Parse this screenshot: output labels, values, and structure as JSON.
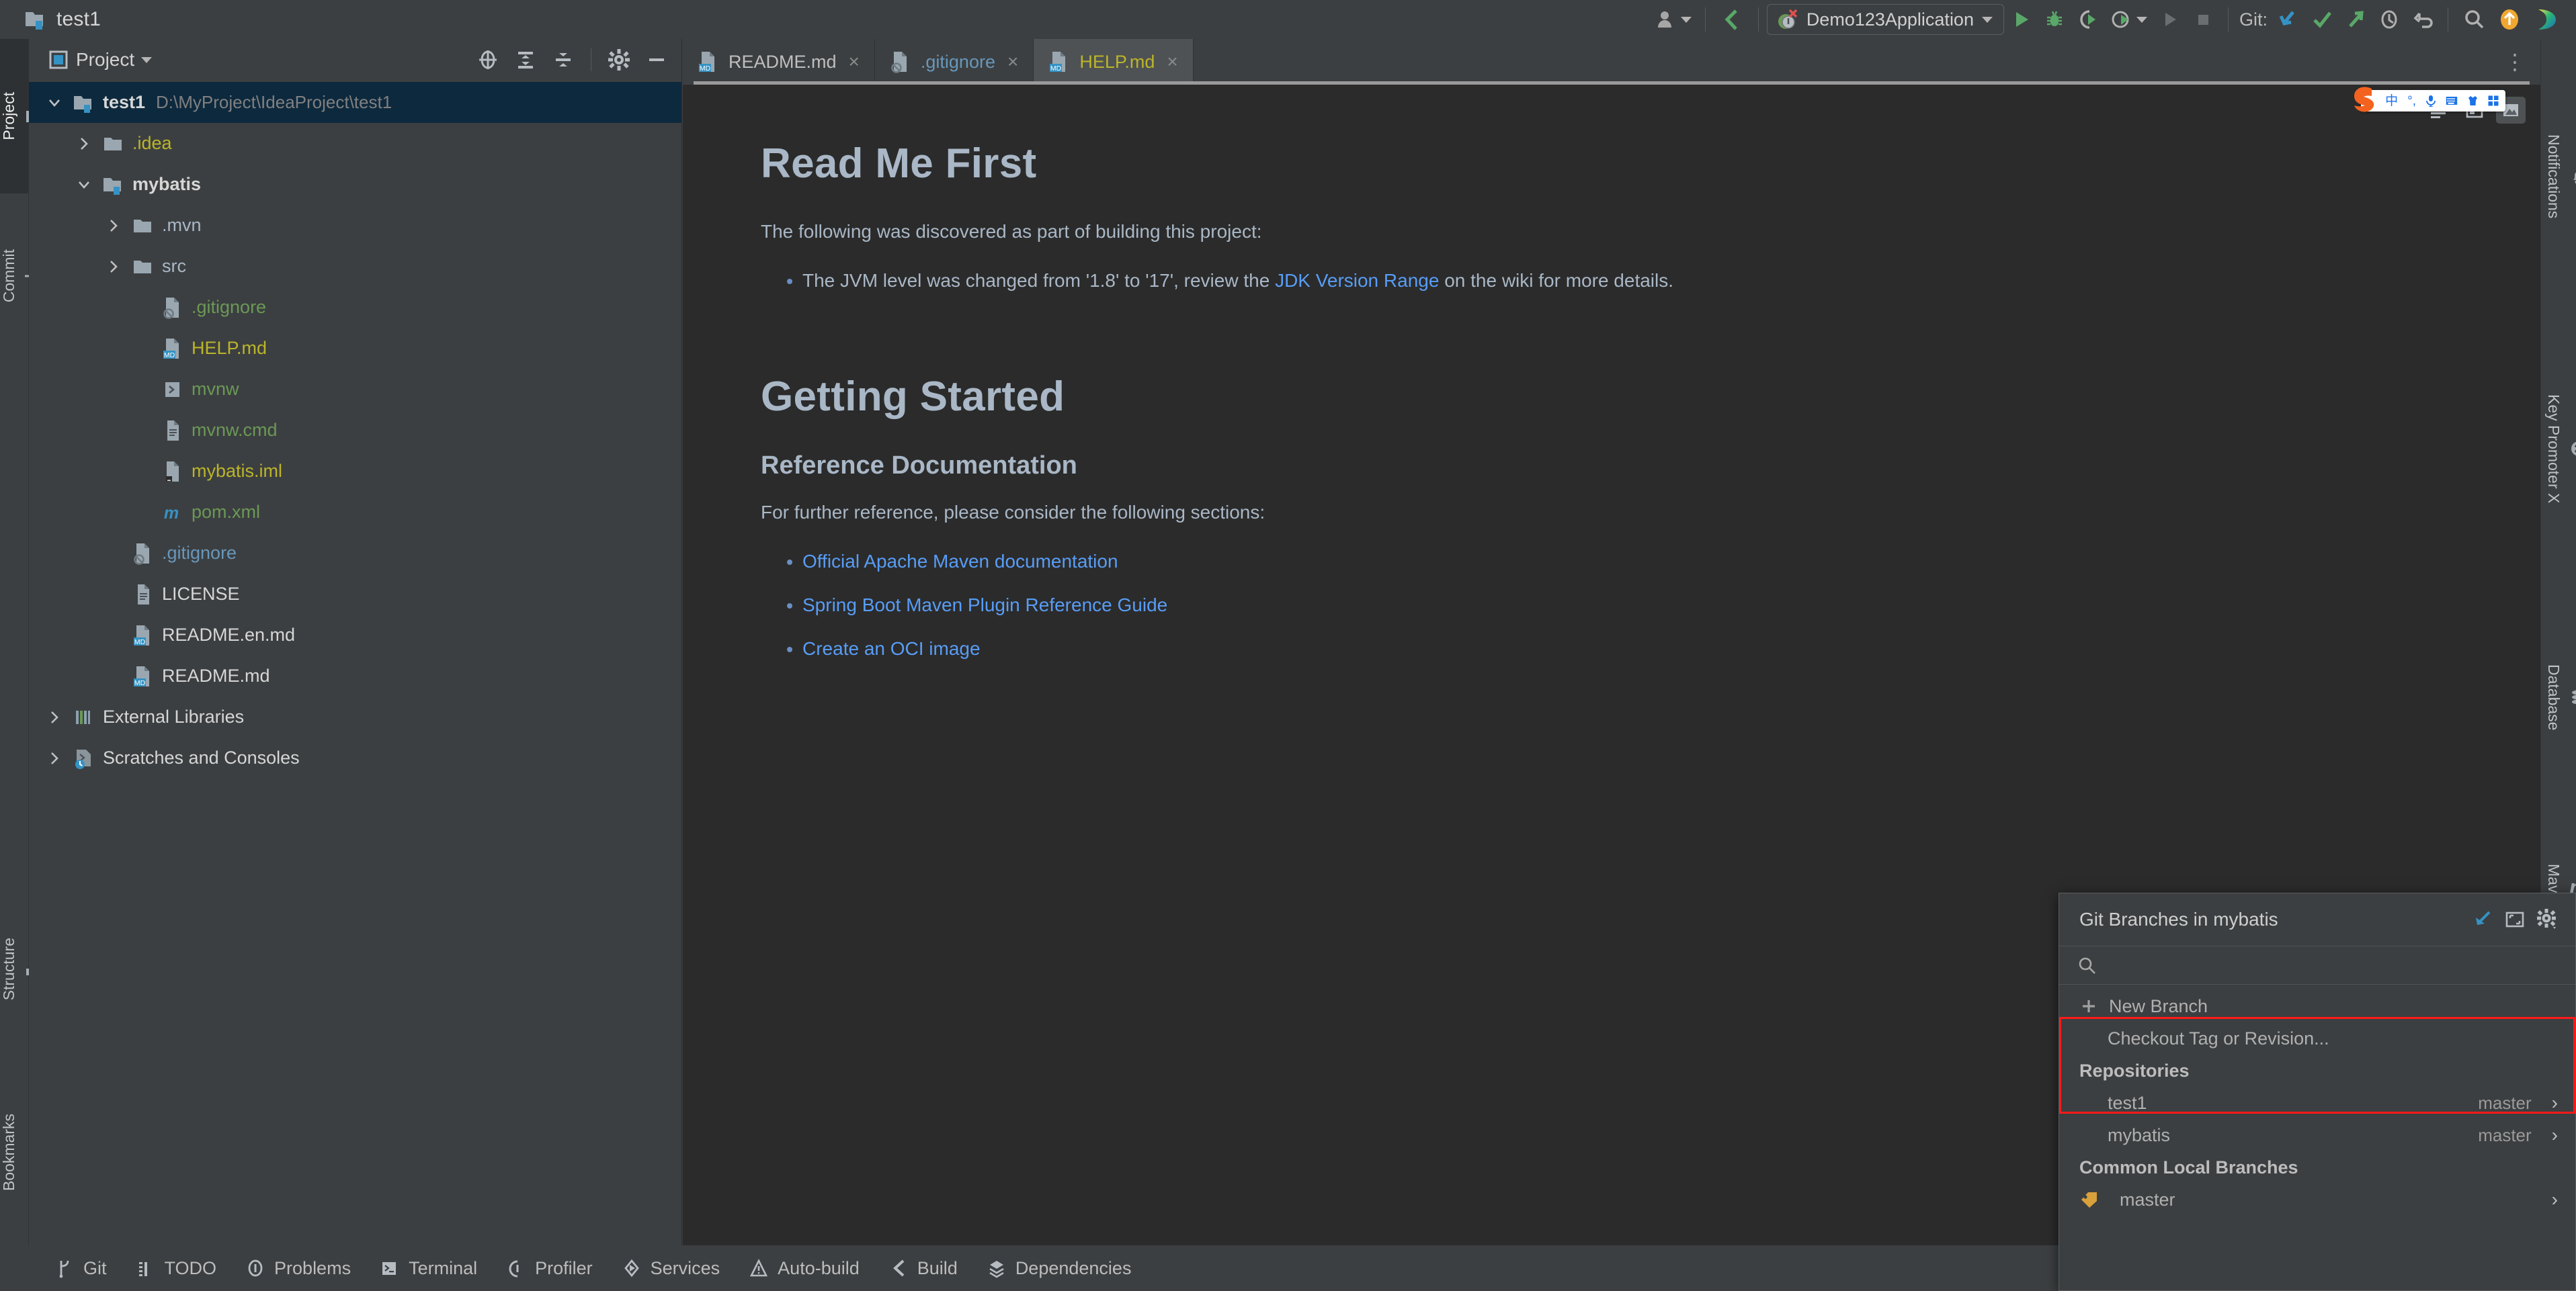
{
  "window": {
    "project_name": "test1"
  },
  "toolbar": {
    "account_icon": "user-avatar-icon",
    "back_icon": "chevron-back-icon",
    "run_config": {
      "label": "Demo123Application",
      "icon": "spring-boot-icon"
    },
    "run_label": "Run",
    "debug_label": "Debug",
    "run_with_coverage_label": "Run with Coverage",
    "profiler_label": "Profiler",
    "run_disabled_label": "Run",
    "stop_label": "Stop",
    "git_label": "Git:",
    "git_update_label": "Update Project",
    "git_commit_label": "Commit",
    "git_push_label": "Push",
    "git_history_label": "History",
    "git_rollback_label": "Rollback",
    "search_label": "Search Everywhere",
    "updates_label": "Updates Available",
    "ide_label": "IDE"
  },
  "left_rail": {
    "tabs": [
      {
        "label": "Project",
        "icon": "folder-icon",
        "selected": true
      },
      {
        "label": "Commit",
        "icon": "commit-icon",
        "selected": false
      },
      {
        "label": "Structure",
        "icon": "structure-icon",
        "selected": false
      },
      {
        "label": "Bookmarks",
        "icon": "bookmark-icon",
        "selected": false
      }
    ]
  },
  "right_rail": {
    "tabs": [
      {
        "label": "Notifications",
        "icon": "bell-icon"
      },
      {
        "label": "Key Promoter X",
        "icon": "key-promoter-icon"
      },
      {
        "label": "Database",
        "icon": "database-icon"
      },
      {
        "label": "Maven",
        "icon": "maven-icon"
      }
    ]
  },
  "project_panel": {
    "title": "Project",
    "icons": {
      "select_opened_file": "crosshair-icon",
      "expand_all": "expand-all-icon",
      "collapse_all": "collapse-all-icon",
      "settings": "gear-icon",
      "hide": "minimize-icon"
    },
    "tree": [
      {
        "label": "test1",
        "path": "D:\\MyProject\\IdeaProject\\test1",
        "indent": 0,
        "twist": "down",
        "icon": "module-icon",
        "selected": true,
        "color": "#d6d6d6",
        "bold": true
      },
      {
        "label": ".idea",
        "path": "",
        "indent": 1,
        "twist": "right",
        "icon": "folder-icon",
        "selected": false,
        "color": "#bbb529",
        "bold": false
      },
      {
        "label": "mybatis",
        "path": "",
        "indent": 1,
        "twist": "down",
        "icon": "module-icon",
        "selected": false,
        "color": "#d6d6d6",
        "bold": true
      },
      {
        "label": ".mvn",
        "path": "",
        "indent": 2,
        "twist": "right",
        "icon": "folder-icon",
        "selected": false,
        "color": "#a9b7c6",
        "bold": false
      },
      {
        "label": "src",
        "path": "",
        "indent": 2,
        "twist": "right",
        "icon": "folder-icon",
        "selected": false,
        "color": "#a9b7c6",
        "bold": false
      },
      {
        "label": ".gitignore",
        "path": "",
        "indent": 3,
        "twist": "none",
        "icon": "gitignore-icon",
        "selected": false,
        "color": "#6a9955",
        "bold": false
      },
      {
        "label": "HELP.md",
        "path": "",
        "indent": 3,
        "twist": "none",
        "icon": "md-icon",
        "selected": false,
        "color": "#bbb529",
        "bold": false
      },
      {
        "label": "mvnw",
        "path": "",
        "indent": 3,
        "twist": "none",
        "icon": "script-icon",
        "selected": false,
        "color": "#6a9955",
        "bold": false
      },
      {
        "label": "mvnw.cmd",
        "path": "",
        "indent": 3,
        "twist": "none",
        "icon": "text-icon",
        "selected": false,
        "color": "#6a9955",
        "bold": false
      },
      {
        "label": "mybatis.iml",
        "path": "",
        "indent": 3,
        "twist": "none",
        "icon": "iml-icon",
        "selected": false,
        "color": "#bbb529",
        "bold": false
      },
      {
        "label": "pom.xml",
        "path": "",
        "indent": 3,
        "twist": "none",
        "icon": "maven-pom-icon",
        "selected": false,
        "color": "#6a9955",
        "bold": false
      },
      {
        "label": ".gitignore",
        "path": "",
        "indent": 2,
        "twist": "none",
        "icon": "gitignore-icon",
        "selected": false,
        "color": "#6897bb",
        "bold": false
      },
      {
        "label": "LICENSE",
        "path": "",
        "indent": 2,
        "twist": "none",
        "icon": "text-icon",
        "selected": false,
        "color": "#d6d6d6",
        "bold": false
      },
      {
        "label": "README.en.md",
        "path": "",
        "indent": 2,
        "twist": "none",
        "icon": "md-icon",
        "selected": false,
        "color": "#d6d6d6",
        "bold": false
      },
      {
        "label": "README.md",
        "path": "",
        "indent": 2,
        "twist": "none",
        "icon": "md-icon",
        "selected": false,
        "color": "#d6d6d6",
        "bold": false
      },
      {
        "label": "External Libraries",
        "path": "",
        "indent": 0,
        "twist": "right",
        "icon": "libraries-icon",
        "selected": false,
        "color": "#d6d6d6",
        "bold": false
      },
      {
        "label": "Scratches and Consoles",
        "path": "",
        "indent": 0,
        "twist": "right",
        "icon": "scratches-icon",
        "selected": false,
        "color": "#d6d6d6",
        "bold": false
      }
    ]
  },
  "editor": {
    "tabs": [
      {
        "label": "README.md",
        "icon": "md-icon",
        "active": false,
        "color": "#bfbfbf"
      },
      {
        "label": ".gitignore",
        "icon": "gitignore-icon",
        "active": false,
        "color": "#6897bb"
      },
      {
        "label": "HELP.md",
        "icon": "md-icon",
        "active": true,
        "color": "#bbb529"
      }
    ],
    "close_glyph": "×",
    "more_glyph": "⋮",
    "view_modes": [
      {
        "name": "editor-only-view",
        "selected": false
      },
      {
        "name": "split-view",
        "selected": false
      },
      {
        "name": "preview-view",
        "selected": true
      }
    ],
    "content": {
      "h1_first": "Read Me First",
      "intro": "The following was discovered as part of building this project:",
      "bullet1_pre": "The JVM level was changed from '1.8' to '17', review the ",
      "bullet1_link": "JDK Version Range",
      "bullet1_post": " on the wiki for more details.",
      "h1_second": "Getting Started",
      "h3_ref": "Reference Documentation",
      "ref_intro": "For further reference, please consider the following sections:",
      "links": [
        "Official Apache Maven documentation",
        "Spring Boot Maven Plugin Reference Guide",
        "Create an OCI image"
      ]
    }
  },
  "ime_bar": {
    "logo": "sogou-logo-icon",
    "items": [
      {
        "name": "chinese-mode-icon",
        "glyph": "中"
      },
      {
        "name": "punctuation-icon",
        "glyph": "°,"
      },
      {
        "name": "microphone-icon",
        "glyph": "🎤"
      },
      {
        "name": "keyboard-icon",
        "glyph": "⌨"
      },
      {
        "name": "skin-icon",
        "glyph": "👕"
      },
      {
        "name": "toolbox-icon",
        "glyph": "⌸"
      }
    ]
  },
  "git_popup": {
    "title": "Git Branches in mybatis",
    "header_icons": {
      "restore": "restore-window-icon",
      "maximize": "maximize-icon",
      "settings": "gear-icon"
    },
    "search_placeholder": "",
    "search_value": "",
    "new_branch_label": "New Branch",
    "new_branch_icon": "plus-icon",
    "checkout_label": "Checkout Tag or Revision...",
    "repositories_header": "Repositories",
    "repositories": [
      {
        "name": "test1",
        "branch": "master"
      },
      {
        "name": "mybatis",
        "branch": "master"
      }
    ],
    "common_local_branches_header": "Common Local Branches",
    "branches": [
      {
        "name": "master",
        "icon": "tag-icon"
      }
    ],
    "chevron_glyph": "›",
    "highlight_color": "#ff1a1a"
  },
  "status_bar": {
    "items": [
      {
        "label": "Git",
        "icon": "git-branch-icon"
      },
      {
        "label": "TODO",
        "icon": "todo-icon"
      },
      {
        "label": "Problems",
        "icon": "problems-icon"
      },
      {
        "label": "Terminal",
        "icon": "terminal-icon"
      },
      {
        "label": "Profiler",
        "icon": "profiler-icon"
      },
      {
        "label": "Services",
        "icon": "services-icon"
      },
      {
        "label": "Auto-build",
        "icon": "auto-build-icon"
      },
      {
        "label": "Build",
        "icon": "build-icon"
      },
      {
        "label": "Dependencies",
        "icon": "dependencies-icon"
      }
    ]
  },
  "colors": {
    "bg_chrome": "#3c3f41",
    "bg_editor": "#2b2b2b",
    "selection": "#0d293e",
    "text": "#bbbbbb",
    "link": "#589df6",
    "accent_green": "#59a869",
    "accent_blue": "#3592c4",
    "accent_yellow": "#bbb529",
    "highlight_red": "#ff1a1a"
  }
}
